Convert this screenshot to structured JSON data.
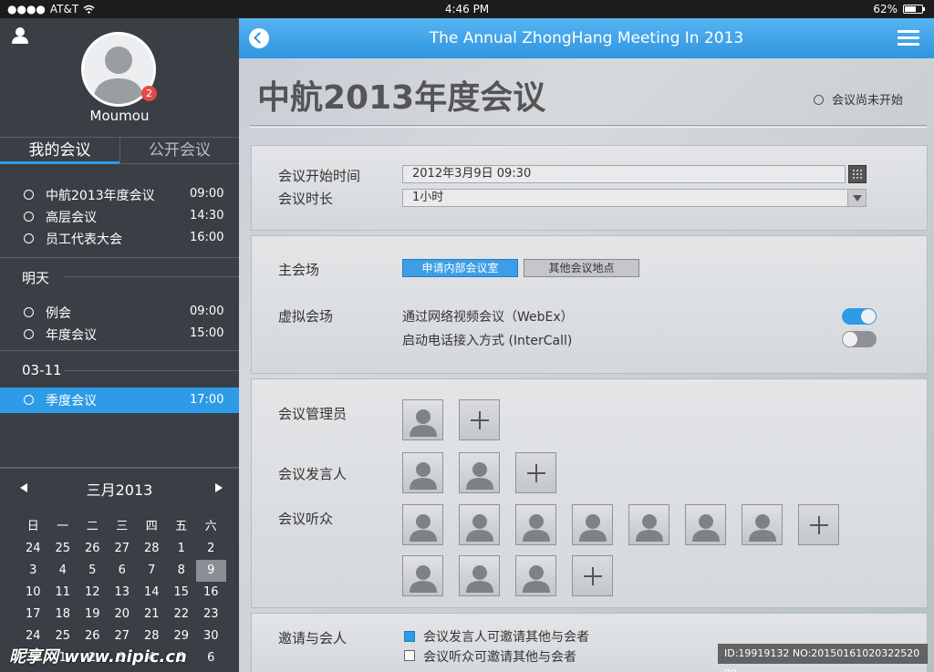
{
  "status_bar": {
    "carrier": "AT&T",
    "time": "4:46 PM",
    "battery": "62%"
  },
  "header": {
    "title": "The Annual  ZhongHang Meeting In 2013"
  },
  "sidebar": {
    "username": "Moumou",
    "badge_count": "2",
    "tabs": [
      "我的会议",
      "公开会议"
    ],
    "today": [
      {
        "name": "中航2013年度会议",
        "time": "09:00"
      },
      {
        "name": "高层会议",
        "time": "14:30"
      },
      {
        "name": "员工代表大会",
        "time": "16:00"
      }
    ],
    "tomorrow_label": "明天",
    "tomorrow": [
      {
        "name": "例会",
        "time": "09:00"
      },
      {
        "name": "年度会议",
        "time": "15:00"
      }
    ],
    "date_label": "03-11",
    "date_items": [
      {
        "name": "季度会议",
        "time": "17:00"
      }
    ]
  },
  "calendar": {
    "month": "三月2013",
    "weekdays": [
      "日",
      "一",
      "二",
      "三",
      "四",
      "五",
      "六"
    ],
    "days": [
      "24",
      "25",
      "26",
      "27",
      "28",
      "1",
      "2",
      "3",
      "4",
      "5",
      "6",
      "7",
      "8",
      "9",
      "10",
      "11",
      "12",
      "13",
      "14",
      "15",
      "16",
      "17",
      "18",
      "19",
      "20",
      "21",
      "22",
      "23",
      "24",
      "25",
      "26",
      "27",
      "28",
      "29",
      "30",
      "31",
      "1",
      "2",
      "3",
      "4",
      "5",
      "6"
    ],
    "selected_day": "9"
  },
  "main": {
    "title": "中航2013年度会议",
    "status": "会议尚未开始",
    "start_time_label": "会议开始时间",
    "start_time_value": "2012年3月9日  09:30",
    "duration_label": "会议时长",
    "duration_value": "1小时",
    "main_venue_label": "主会场",
    "btn_internal_room": "申请内部会议室",
    "btn_other_venue": "其他会议地点",
    "virtual_venue_label": "虚拟会场",
    "webex_label": "通过网络视频会议（WebEx）",
    "webex_on": true,
    "intercall_label": "启动电话接入方式 (InterCall)",
    "intercall_on": false,
    "admins_label": "会议管理员",
    "speakers_label": "会议发言人",
    "audience_label": "会议听众",
    "invite_label": "邀请与会人",
    "invite_opt1": "会议发言人可邀请其他与会者",
    "invite_opt1_checked": true,
    "invite_opt2": "会议听众可邀请其他与会者",
    "invite_opt2_checked": false
  },
  "watermark": {
    "left": "昵享网 www.nipic.cn",
    "right": "ID:19919132 NO:20150161020322520​00"
  },
  "colors": {
    "accent": "#2d9be6",
    "sidebar_bg": "#3a3f46",
    "badge": "#e24b4b"
  }
}
